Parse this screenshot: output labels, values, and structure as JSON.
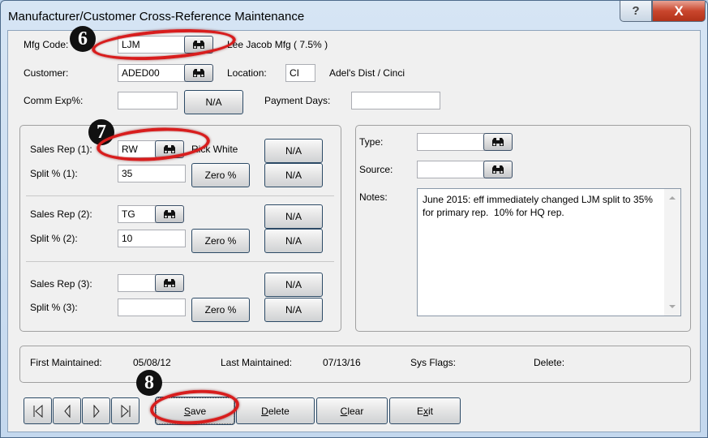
{
  "window": {
    "title": "Manufacturer/Customer Cross-Reference Maintenance",
    "help_label": "?",
    "close_label": "X"
  },
  "header": {
    "mfg_code_label": "Mfg Code:",
    "mfg_code_value": "LJM",
    "mfg_name": "Lee Jacob Mfg ( 7.5% )",
    "customer_label": "Customer:",
    "customer_value": "ADED00",
    "location_label": "Location:",
    "location_value": "CI",
    "location_name": "Adel's Dist / Cinci",
    "comm_exp_label": "Comm Exp%:",
    "comm_exp_value": "",
    "comm_na_label": "N/A",
    "payment_days_label": "Payment Days:",
    "payment_days_value": ""
  },
  "sales_reps": [
    {
      "rep_label": "Sales Rep (1):",
      "rep_value": "RW",
      "rep_name": "Rick White",
      "split_label": "Split % (1):",
      "split_value": "35",
      "zero_label": "Zero %",
      "na_rep_label": "N/A",
      "na_split_label": "N/A"
    },
    {
      "rep_label": "Sales Rep (2):",
      "rep_value": "TG",
      "rep_name": "",
      "split_label": "Split % (2):",
      "split_value": "10",
      "zero_label": "Zero %",
      "na_rep_label": "N/A",
      "na_split_label": "N/A"
    },
    {
      "rep_label": "Sales Rep (3):",
      "rep_value": "",
      "rep_name": "",
      "split_label": "Split % (3):",
      "split_value": "",
      "zero_label": "Zero %",
      "na_rep_label": "N/A",
      "na_split_label": "N/A"
    }
  ],
  "details": {
    "type_label": "Type:",
    "type_value": "",
    "source_label": "Source:",
    "source_value": "",
    "notes_label": "Notes:",
    "notes_value": "June 2015: eff immediately changed LJM split to 35%\nfor primary rep.  10% for HQ rep."
  },
  "status": {
    "first_maintained_label": "First Maintained:",
    "first_maintained_value": "05/08/12",
    "last_maintained_label": "Last Maintained:",
    "last_maintained_value": "07/13/16",
    "sys_flags_label": "Sys Flags:",
    "delete_label": "Delete:"
  },
  "toolbar": {
    "save_label": "Save",
    "save_mnemonic": "S",
    "save_rest": "ave",
    "delete_mnemonic": "D",
    "delete_rest": "elete",
    "clear_mnemonic": "C",
    "clear_rest": "lear",
    "exit_pre": "E",
    "exit_mnemonic": "x",
    "exit_rest": "it"
  },
  "annotations": {
    "step_6": "6",
    "step_7": "7",
    "step_8": "8",
    "ring_color": "#d81d1d"
  }
}
